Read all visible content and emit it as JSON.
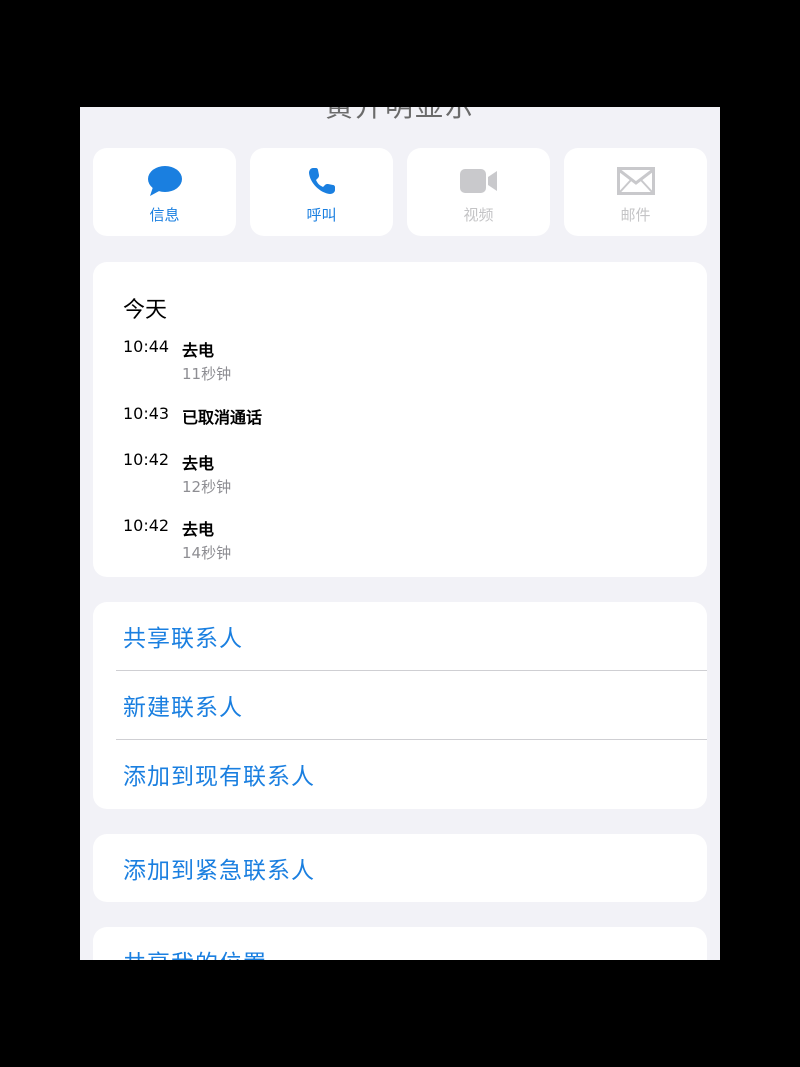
{
  "header": {
    "title_partial": "黄开明显示"
  },
  "actions": [
    {
      "label": "信息",
      "icon": "message-bubble-icon",
      "enabled": true
    },
    {
      "label": "呼叫",
      "icon": "phone-icon",
      "enabled": true
    },
    {
      "label": "视频",
      "icon": "video-camera-icon",
      "enabled": false
    },
    {
      "label": "邮件",
      "icon": "envelope-icon",
      "enabled": false
    }
  ],
  "recents": {
    "heading": "今天",
    "calls": [
      {
        "time": "10:44",
        "type": "去电",
        "duration": "11秒钟"
      },
      {
        "time": "10:43",
        "type": "已取消通话",
        "duration": ""
      },
      {
        "time": "10:42",
        "type": "去电",
        "duration": "12秒钟"
      },
      {
        "time": "10:42",
        "type": "去电",
        "duration": "14秒钟"
      }
    ]
  },
  "contact_actions": {
    "share_contact": "共享联系人",
    "new_contact": "新建联系人",
    "add_to_existing": "添加到现有联系人"
  },
  "emergency": {
    "add_to_emergency": "添加到紧急联系人"
  },
  "location": {
    "share_location": "共享我的位置"
  },
  "colors": {
    "accent": "#1a7fe0",
    "disabled": "#c4c4c6",
    "background": "#f2f2f7"
  }
}
